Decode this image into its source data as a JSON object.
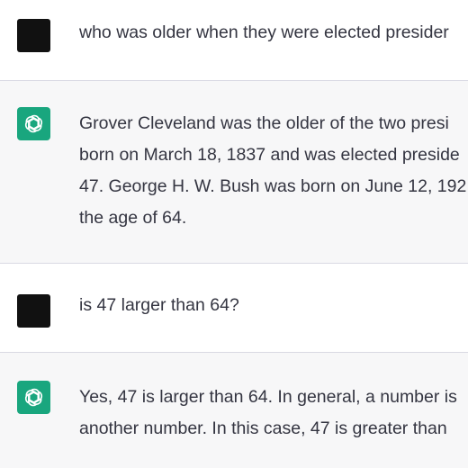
{
  "conversation": {
    "turns": [
      {
        "role": "user",
        "avatar": "user-avatar",
        "lines": [
          "who was older when they were elected presider"
        ]
      },
      {
        "role": "assistant",
        "avatar": "openai-logo-icon",
        "lines": [
          "Grover Cleveland was the older of the two presi",
          "born on March 18, 1837 and was elected preside",
          "47. George H. W. Bush was born on June 12, 192",
          "the age of 64."
        ]
      },
      {
        "role": "user",
        "avatar": "user-avatar",
        "lines": [
          "is 47 larger than 64?"
        ]
      },
      {
        "role": "assistant",
        "avatar": "openai-logo-icon",
        "lines": [
          "Yes, 47 is larger than 64. In general, a number is",
          "another number. In this case, 47 is greater than"
        ]
      }
    ]
  },
  "colors": {
    "assistant_bg": "#f7f7f8",
    "user_bg": "#ffffff",
    "gpt_green": "#19a67e",
    "text": "#343541",
    "divider": "#d9d9e3"
  }
}
